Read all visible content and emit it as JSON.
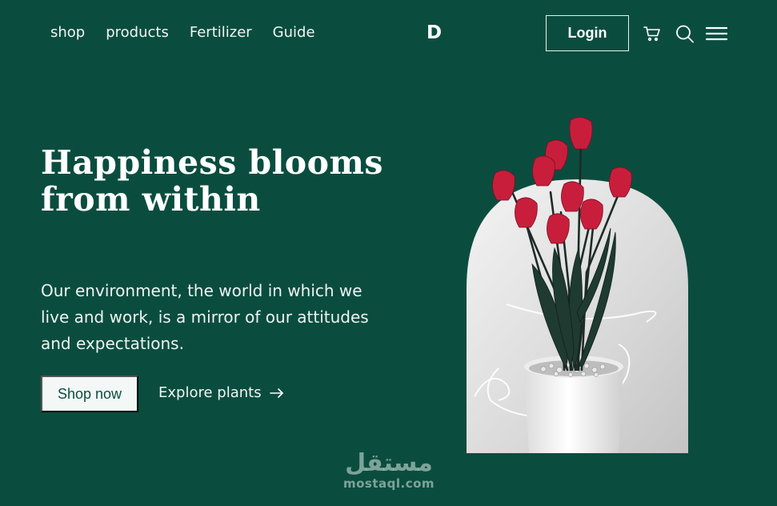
{
  "nav": {
    "links": [
      "shop",
      "products",
      "Fertilizer",
      "Guide"
    ],
    "logo": "D",
    "login_label": "Login",
    "icons": [
      "cart-icon",
      "search-icon",
      "menu-icon"
    ]
  },
  "hero": {
    "title": "Happiness blooms from within",
    "description": "Our environment, the world in which we live and work, is a mirror of our attitudes and expectations.",
    "primary_cta": "Shop now",
    "secondary_cta": "Explore plants",
    "secondary_cta_icon": "arrow-right-icon",
    "image": "red-tulips-in-white-pot"
  },
  "watermark": {
    "arabic": "مستقل",
    "latin": "mostaql.com"
  },
  "colors": {
    "background": "#0a4d3f",
    "text": "#ffffff",
    "button_bg": "#f3f7f6",
    "tulip": "#c81e3c"
  }
}
